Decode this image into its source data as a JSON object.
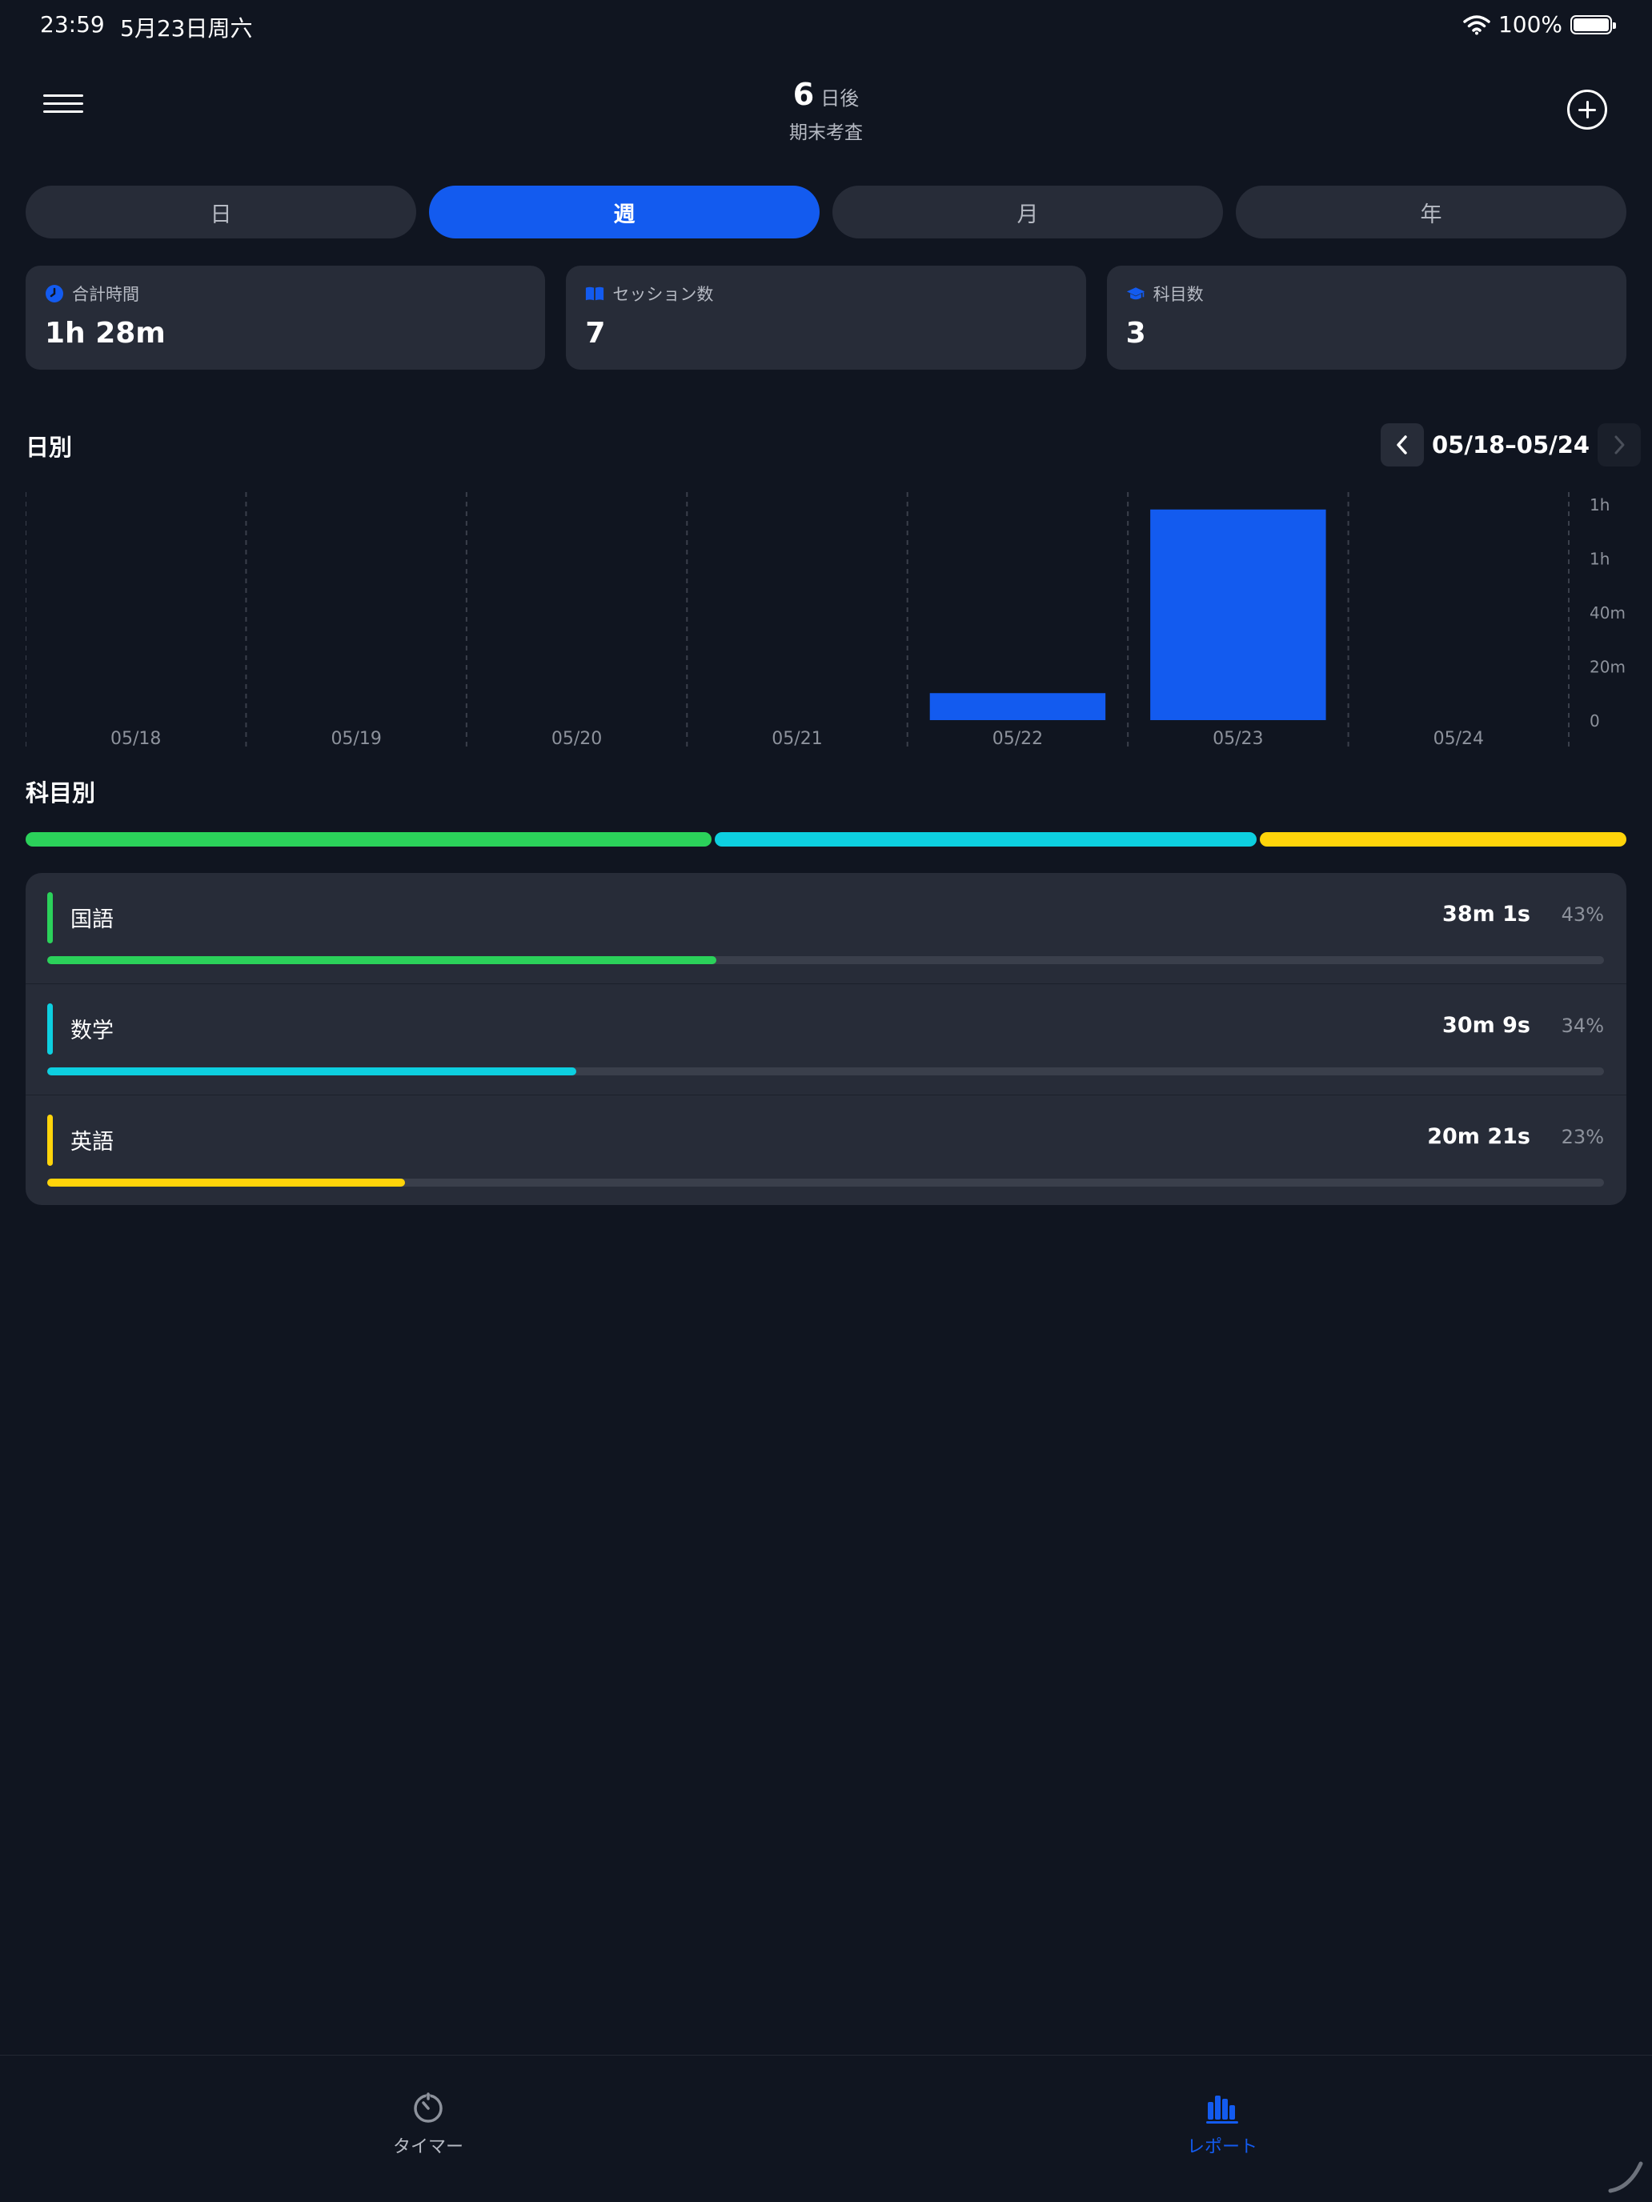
{
  "status_bar": {
    "time": "23:59",
    "date": "5月23日周六",
    "battery": "100%"
  },
  "header": {
    "countdown_number": "6",
    "countdown_unit": "日後",
    "exam_name": "期末考査"
  },
  "period_tabs": [
    {
      "label": "日",
      "active": false
    },
    {
      "label": "週",
      "active": true
    },
    {
      "label": "月",
      "active": false
    },
    {
      "label": "年",
      "active": false
    }
  ],
  "stats": [
    {
      "label": "合計時間",
      "value": "1h 28m",
      "icon": "clock-icon"
    },
    {
      "label": "セッション数",
      "value": "7",
      "icon": "book-icon"
    },
    {
      "label": "科目数",
      "value": "3",
      "icon": "graduation-cap-icon"
    }
  ],
  "daily": {
    "title": "日別",
    "range_label": "05/18–05/24"
  },
  "chart_data": {
    "type": "bar",
    "categories": [
      "05/18",
      "05/19",
      "05/20",
      "05/21",
      "05/22",
      "05/23",
      "05/24"
    ],
    "values": [
      0,
      0,
      0,
      0,
      10,
      78,
      0
    ],
    "y_unit": "minutes",
    "ylim": [
      0,
      80
    ],
    "y_ticks": [
      {
        "value": 0,
        "label": "0"
      },
      {
        "value": 20,
        "label": "20m"
      },
      {
        "value": 40,
        "label": "40m"
      },
      {
        "value": 60,
        "label": "1h"
      },
      {
        "value": 80,
        "label": "1h"
      }
    ],
    "bar_color": "#135bef",
    "grid": "vertical dashed"
  },
  "subjects": {
    "title": "科目別",
    "items": [
      {
        "name": "国語",
        "time": "38m 1s",
        "percent": "43%",
        "share": 0.43,
        "color": "#2bd15a"
      },
      {
        "name": "数学",
        "time": "30m 9s",
        "percent": "34%",
        "share": 0.34,
        "color": "#0dcfe0"
      },
      {
        "name": "英語",
        "time": "20m 21s",
        "percent": "23%",
        "share": 0.23,
        "color": "#ffd40a"
      }
    ]
  },
  "tabbar": [
    {
      "label": "タイマー",
      "icon": "timer-icon",
      "active": false
    },
    {
      "label": "レポート",
      "icon": "bar-chart-icon",
      "active": true
    }
  ],
  "colors": {
    "accent": "#135bef",
    "background": "#101520",
    "card": "#272c38"
  }
}
